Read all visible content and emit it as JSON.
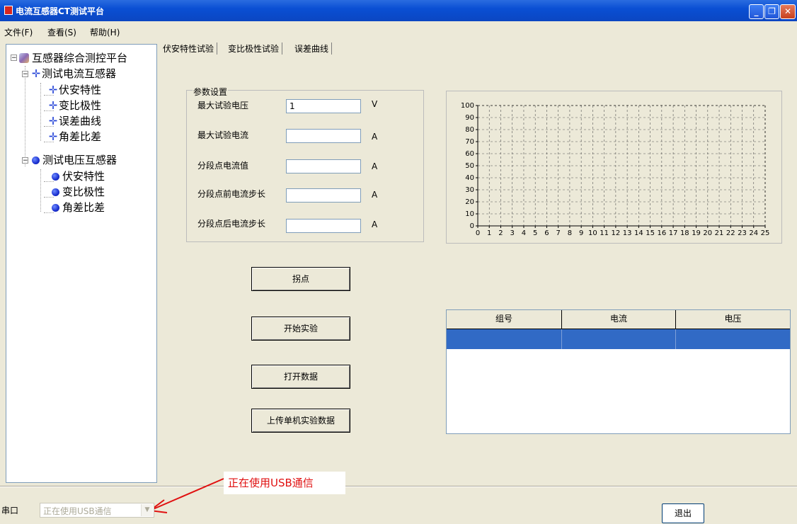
{
  "window": {
    "title": "电流互感器CT测试平台",
    "minimize": "_",
    "maximize": "❐",
    "close": "✕"
  },
  "menu": [
    "文件(F)",
    "查看(S)",
    "帮助(H)"
  ],
  "tree": {
    "root": "互感器综合测控平台",
    "groups": [
      {
        "label": "测试电流互感器",
        "items": [
          "伏安特性",
          "变比极性",
          "误差曲线",
          "角差比差"
        ]
      },
      {
        "label": "测试电压互感器",
        "items": [
          "伏安特性",
          "变比极性",
          "角差比差"
        ]
      }
    ]
  },
  "tabs": [
    "伏安特性试验",
    "变比极性试验",
    "误差曲线"
  ],
  "params": {
    "title": "参数设置",
    "fields": [
      {
        "label": "最大试验电压",
        "value": "1",
        "unit": "V"
      },
      {
        "label": "最大试验电流",
        "value": "",
        "unit": "A"
      },
      {
        "label": "分段点电流值",
        "value": "",
        "unit": "A"
      },
      {
        "label": "分段点前电流步长",
        "value": "",
        "unit": "A"
      },
      {
        "label": "分段点后电流步长",
        "value": "",
        "unit": "A"
      }
    ]
  },
  "buttons": {
    "knee": "拐点",
    "start": "开始实验",
    "open": "打开数据",
    "upload": "上传单机实验数据",
    "exit": "退出"
  },
  "chart_data": {
    "type": "line",
    "xlim": [
      0,
      25
    ],
    "ylim": [
      0,
      100
    ],
    "xticks": [
      "0",
      "1",
      "2",
      "3",
      "4",
      "5",
      "6",
      "7",
      "8",
      "9",
      "10",
      "11",
      "12",
      "13",
      "14",
      "15",
      "16",
      "17",
      "18",
      "19",
      "20",
      "21",
      "22",
      "23",
      "24",
      "25"
    ],
    "yticks": [
      "0",
      "10",
      "20",
      "30",
      "40",
      "50",
      "60",
      "70",
      "80",
      "90",
      "100"
    ],
    "grid": true,
    "series": []
  },
  "table": {
    "columns": [
      "组号",
      "电流",
      "电压"
    ],
    "rows": [
      [
        "",
        "",
        ""
      ]
    ],
    "selected_color": "#316ac5"
  },
  "bottom": {
    "port_label": "串口",
    "combo_value": "正在使用USB通信",
    "callout": "正在使用USB通信"
  }
}
